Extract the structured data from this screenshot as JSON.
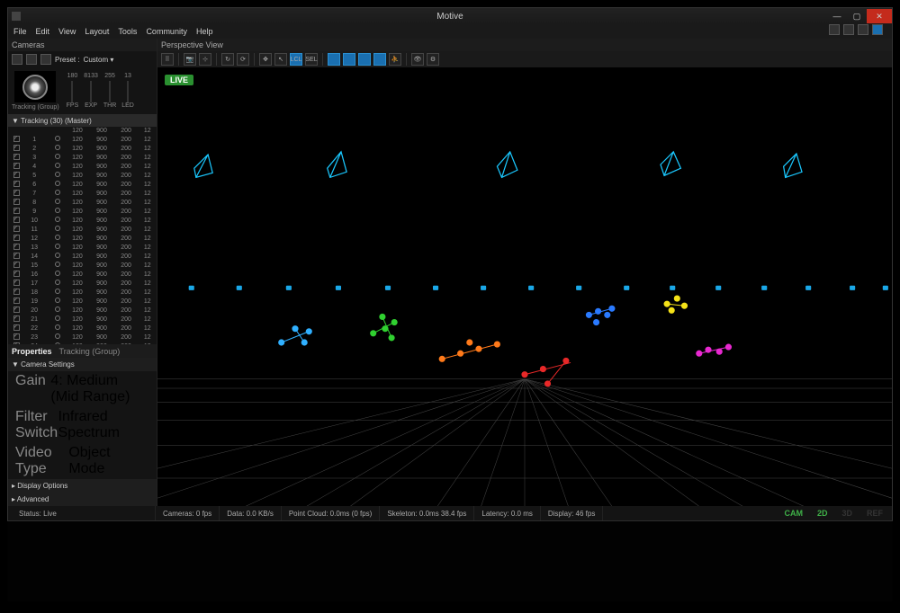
{
  "title": "Motive",
  "menu": [
    "File",
    "Edit",
    "View",
    "Layout",
    "Tools",
    "Community",
    "Help"
  ],
  "cameras_panel": {
    "title": "Cameras",
    "preset_label": "Preset :",
    "preset_value": "Custom ▾",
    "sliders": {
      "a": "180",
      "b": "8133",
      "c": "255",
      "d": "13"
    },
    "slider_labels": [
      "FPS",
      "EXP",
      "THR",
      "LED"
    ],
    "thumb_label": "Tracking (Group)",
    "group_header": "▼ Tracking (30) (Master)",
    "cols": [
      "",
      "",
      "",
      "",
      "120",
      "900",
      "200",
      "12"
    ],
    "row_vals": [
      "120",
      "900",
      "200",
      "12"
    ]
  },
  "properties": {
    "tab1": "Properties",
    "tab2": "Tracking (Group)",
    "section": "▼ Camera Settings",
    "gain_lbl": "Gain",
    "gain_val": "4: Medium (Mid Range)",
    "filter_lbl": "Filter Switch",
    "filter_val": "Infrared Spectrum",
    "video_lbl": "Video Type",
    "video_val": "Object Mode",
    "disp": "▸ Display Options",
    "adv": "▸ Advanced"
  },
  "perspective": {
    "title": "Perspective View",
    "live": "LIVE",
    "lcl": "LCL",
    "sel": "SEL"
  },
  "status": {
    "left": "Status: Live",
    "cameras": "Cameras: 0 fps",
    "data": "Data: 0.0 KB/s",
    "pointcloud": "Point Cloud: 0.0ms (0 fps)",
    "skeleton": "Skeleton: 0.0ms 38.4 fps",
    "latency": "Latency: 0.0 ms",
    "display": "Display: 46 fps",
    "cam": "CAM",
    "d2": "2D",
    "d3": "3D",
    "ref": "REF"
  }
}
